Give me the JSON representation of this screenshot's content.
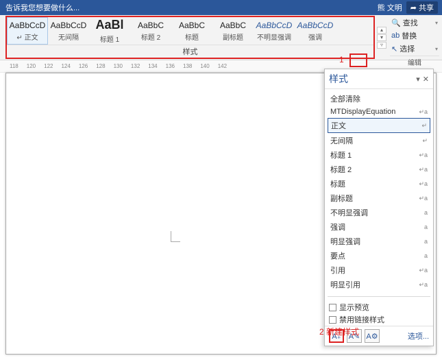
{
  "titlebar": {
    "text": "告诉我您想要做什么...",
    "user": "熊 文明",
    "share": "共享"
  },
  "ribbon": {
    "styles_title": "样式",
    "chips": [
      {
        "preview": "AaBbCcD",
        "label": "正文",
        "cls": "",
        "sel": true
      },
      {
        "preview": "AaBbCcD",
        "label": "无间隔",
        "cls": "",
        "sel": false
      },
      {
        "preview": "AaBl",
        "label": "标题 1",
        "cls": "big",
        "sel": false
      },
      {
        "preview": "AaBbC",
        "label": "标题 2",
        "cls": "",
        "sel": false
      },
      {
        "preview": "AaBbC",
        "label": "标题",
        "cls": "",
        "sel": false
      },
      {
        "preview": "AaBbC",
        "label": "副标题",
        "cls": "",
        "sel": false
      },
      {
        "preview": "AaBbCcD",
        "label": "不明显强调",
        "cls": "em",
        "sel": false
      },
      {
        "preview": "AaBbCcD",
        "label": "强调",
        "cls": "em",
        "sel": false
      }
    ],
    "editing": {
      "find": "查找",
      "replace": "替换",
      "select": "选择",
      "group_label": "编辑"
    }
  },
  "ruler": [
    "118",
    "120",
    "122",
    "124",
    "126",
    "128",
    "130",
    "132",
    "134",
    "136",
    "138",
    "140",
    "142"
  ],
  "annotation1": "1",
  "annotation2": "2 新建样式",
  "panel": {
    "title": "样式",
    "items": [
      {
        "name": "全部清除",
        "suffix": ""
      },
      {
        "name": "MTDisplayEquation",
        "suffix": "↵a"
      },
      {
        "name": "正文",
        "suffix": "↵",
        "sel": true
      },
      {
        "name": "无间隔",
        "suffix": "↵"
      },
      {
        "name": "标题 1",
        "suffix": "↵a"
      },
      {
        "name": "标题 2",
        "suffix": "↵a"
      },
      {
        "name": "标题",
        "suffix": "↵a"
      },
      {
        "name": "副标题",
        "suffix": "↵a"
      },
      {
        "name": "不明显强调",
        "suffix": "a"
      },
      {
        "name": "强调",
        "suffix": "a"
      },
      {
        "name": "明显强调",
        "suffix": "a"
      },
      {
        "name": "要点",
        "suffix": "a"
      },
      {
        "name": "引用",
        "suffix": "↵a"
      },
      {
        "name": "明显引用",
        "suffix": "↵a"
      }
    ],
    "show_preview": "显示预览",
    "disable_linked": "禁用链接样式",
    "options": "选项..."
  }
}
